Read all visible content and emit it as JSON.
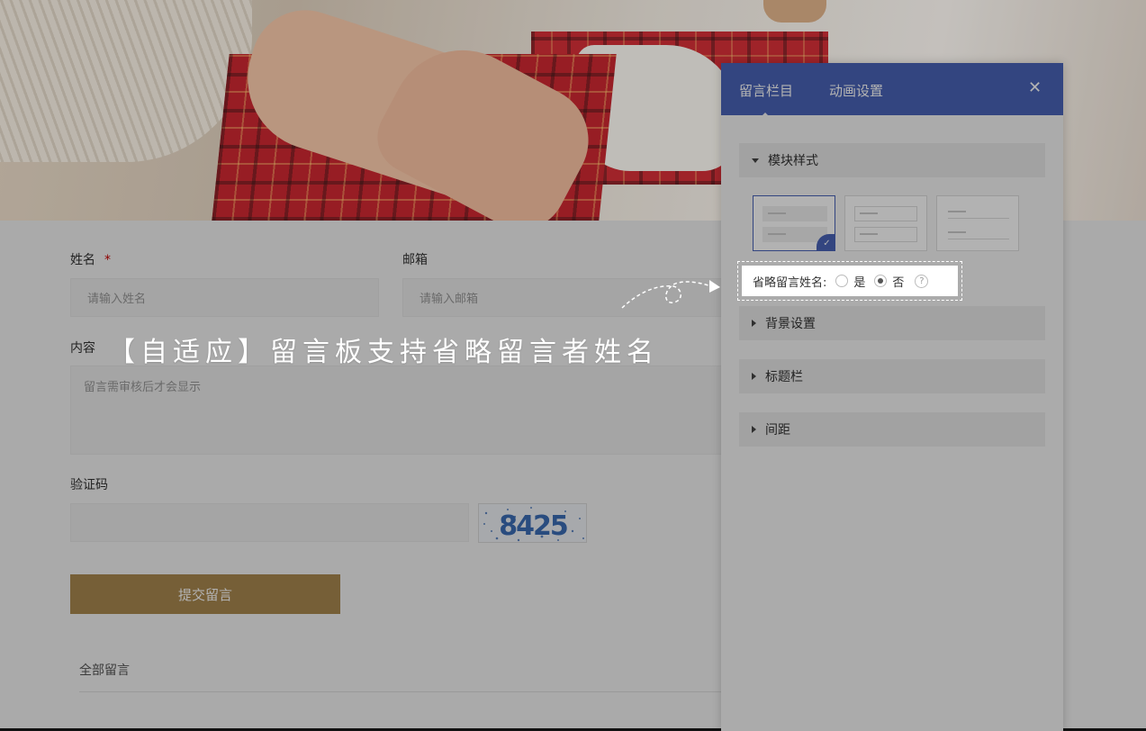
{
  "colors": {
    "accent": "#4a63b8",
    "submit": "#a9894f",
    "required": "#cc0000"
  },
  "form": {
    "name_label": "姓名",
    "required_mark": "*",
    "name_placeholder": "请输入姓名",
    "email_label": "邮箱",
    "email_placeholder": "请输入邮箱",
    "content_label": "内容",
    "content_placeholder": "留言需审核后才会显示",
    "captcha_label": "验证码",
    "captcha_text": "8425",
    "submit_label": "提交留言",
    "all_messages": "全部留言"
  },
  "banner": {
    "text": "【自适应】留言板支持省略留言者姓名"
  },
  "panel": {
    "tabs": [
      {
        "label": "留言栏目"
      },
      {
        "label": "动画设置"
      }
    ],
    "close_icon": "close-icon",
    "sections": {
      "module_style": "模块样式",
      "background": "背景设置",
      "title_bar": "标题栏",
      "spacing": "间距"
    },
    "omit_name": {
      "label": "省略留言姓名:",
      "yes": "是",
      "no": "否",
      "help": "?",
      "selected": "否"
    }
  }
}
